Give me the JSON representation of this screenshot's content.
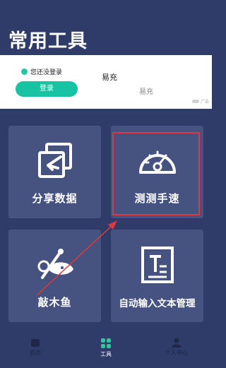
{
  "header": {
    "title": "常用工具"
  },
  "ad": {
    "login_warning": "您还没登录",
    "login_button": "登录",
    "title": "易充",
    "subtitle": "易充",
    "tag": "广告"
  },
  "tools": [
    {
      "label": "分享数据"
    },
    {
      "label": "测测手速"
    },
    {
      "label": "敲木鱼"
    },
    {
      "label": "自动输入文本管理"
    }
  ],
  "tabs": [
    {
      "label": "首页"
    },
    {
      "label": "工具"
    },
    {
      "label": "个人中心"
    }
  ],
  "colors": {
    "background": "#2f3b68",
    "tile": "#46527f",
    "accent": "#18c3a3",
    "highlight": "#e0383a"
  }
}
